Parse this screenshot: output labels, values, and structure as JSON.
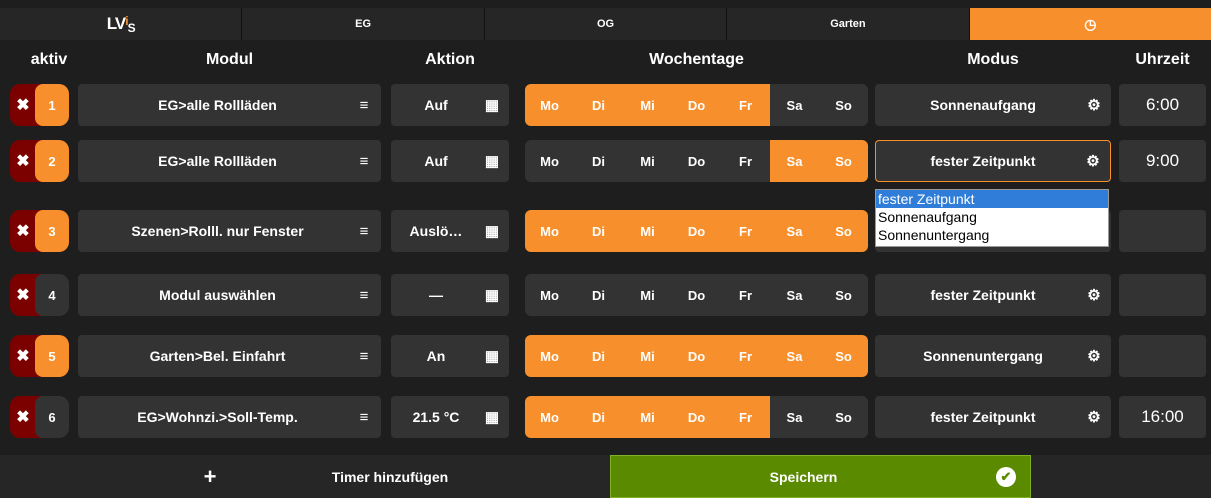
{
  "tabs": [
    {
      "label": "",
      "logo_main": "LV",
      "logo_i": "i",
      "logo_s": "S"
    },
    {
      "label": "EG"
    },
    {
      "label": "OG"
    },
    {
      "label": "Garten"
    },
    {
      "label": "◷"
    }
  ],
  "headers": {
    "aktiv": "aktiv",
    "modul": "Modul",
    "aktion": "Aktion",
    "wochentage": "Wochentage",
    "modus": "Modus",
    "uhrzeit": "Uhrzeit"
  },
  "day_labels": [
    "Mo",
    "Di",
    "Mi",
    "Do",
    "Fr",
    "Sa",
    "So"
  ],
  "rows": [
    {
      "num": "1",
      "active": true,
      "modul": "EG>alle Rollläden",
      "aktion": "Auf",
      "days": [
        1,
        1,
        1,
        1,
        1,
        0,
        0
      ],
      "modus": "Sonnenaufgang",
      "time": "6:00"
    },
    {
      "num": "2",
      "active": true,
      "modul": "EG>alle Rollläden",
      "aktion": "Auf",
      "days": [
        0,
        0,
        0,
        0,
        0,
        1,
        1
      ],
      "modus": "fester Zeitpunkt",
      "time": "9:00"
    },
    {
      "num": "3",
      "active": true,
      "modul": "Szenen>Rolll. nur Fenster",
      "aktion": "Auslö…",
      "days": [
        1,
        1,
        1,
        1,
        1,
        1,
        1
      ],
      "modus": "",
      "time": ""
    },
    {
      "num": "4",
      "active": false,
      "modul": "Modul auswählen",
      "aktion": "—",
      "days": [
        0,
        0,
        0,
        0,
        0,
        0,
        0
      ],
      "modus": "fester Zeitpunkt",
      "time": ""
    },
    {
      "num": "5",
      "active": true,
      "modul": "Garten>Bel. Einfahrt",
      "aktion": "An",
      "days": [
        1,
        1,
        1,
        1,
        1,
        1,
        1
      ],
      "modus": "Sonnenuntergang",
      "time": ""
    },
    {
      "num": "6",
      "active": false,
      "modul": "EG>Wohnzi.>Soll-Temp.",
      "aktion": "21.5 °C",
      "days": [
        1,
        1,
        1,
        1,
        1,
        0,
        0
      ],
      "modus": "fester Zeitpunkt",
      "time": "16:00"
    }
  ],
  "dropdown": {
    "options": [
      "fester Zeitpunkt",
      "Sonnenaufgang",
      "Sonnenuntergang"
    ],
    "selected": "fester Zeitpunkt"
  },
  "bottom": {
    "add_label": "Timer hinzufügen",
    "save_label": "Speichern"
  },
  "colors": {
    "accent": "#f7902c",
    "save_green": "#5a8a00",
    "delete_red": "#7b0000"
  },
  "icons": {
    "close": "✖",
    "menu": "≡",
    "grid": "▦",
    "gear": "⚙",
    "plus": "+",
    "check": "✔"
  }
}
